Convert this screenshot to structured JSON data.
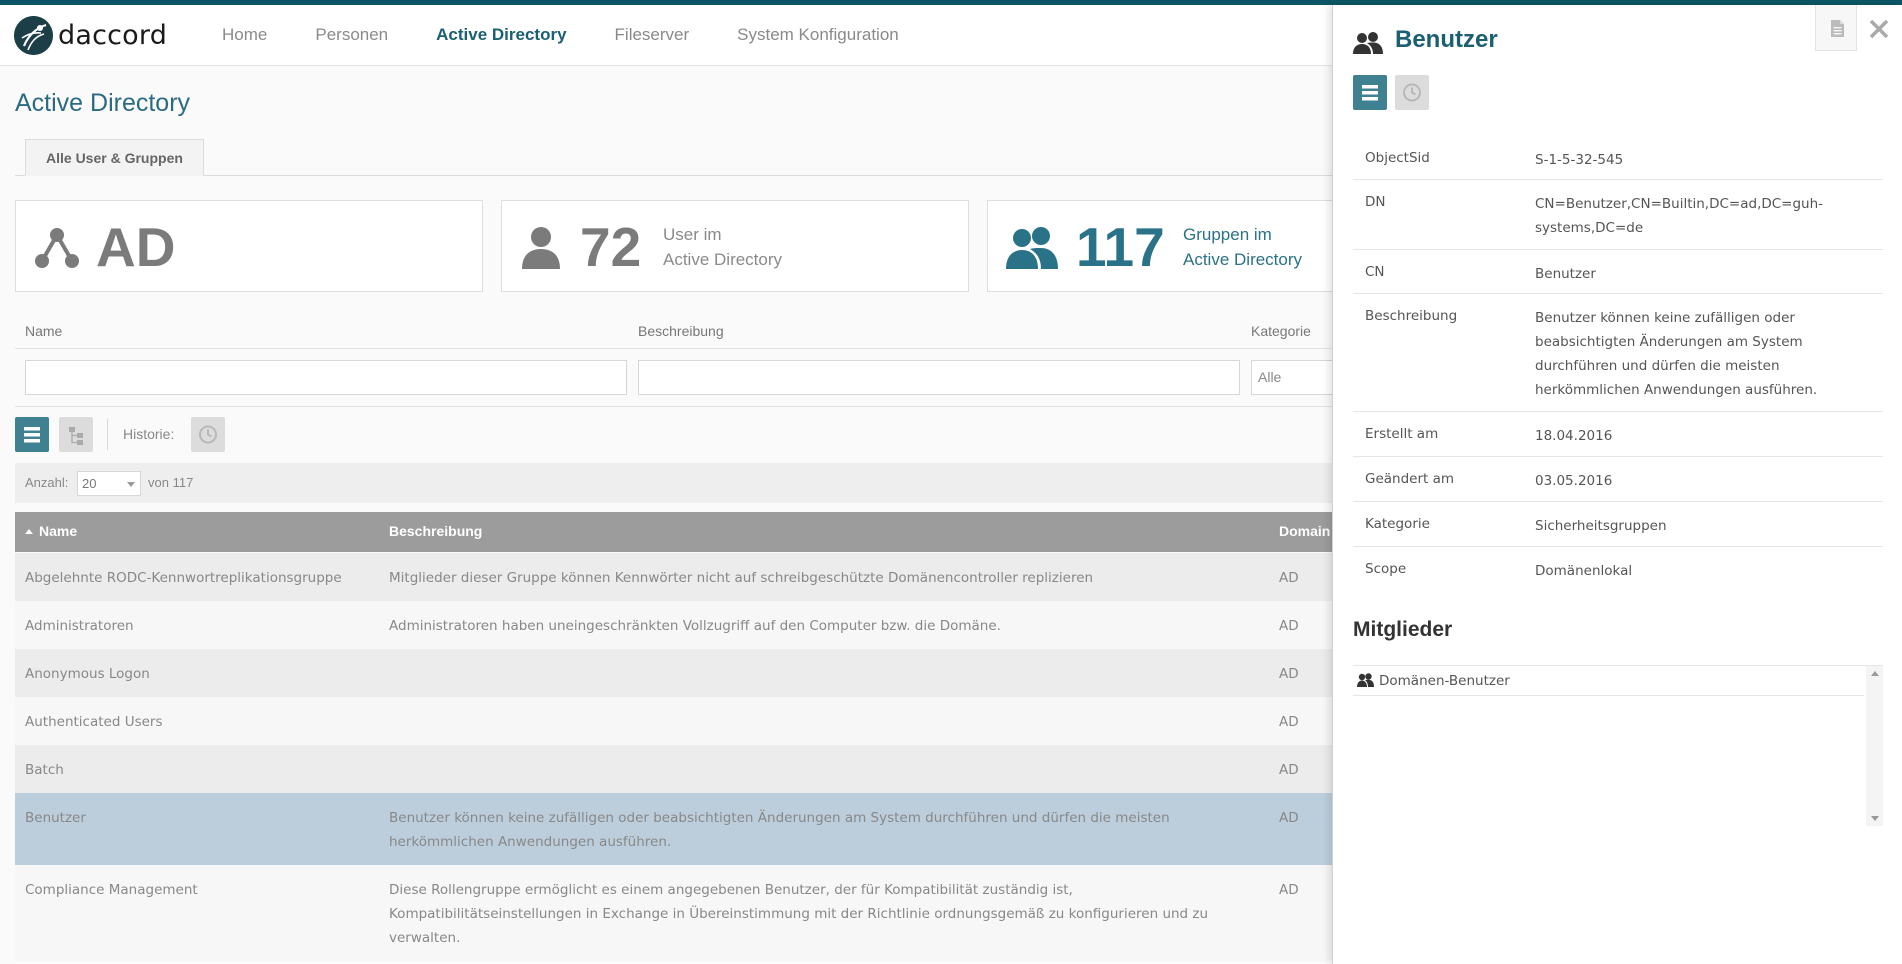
{
  "app": {
    "logo_text": "daccord",
    "nav": [
      "Home",
      "Personen",
      "Active Directory",
      "Fileserver",
      "System Konfiguration"
    ],
    "active_nav": "Active Directory"
  },
  "page": {
    "title": "Active Directory",
    "tab": "Alle User & Gruppen"
  },
  "stats": {
    "ad": {
      "value": "AD",
      "icon": "network-icon"
    },
    "users": {
      "value": "72",
      "line1": "User im",
      "line2": "Active Directory",
      "icon": "user-icon"
    },
    "groups": {
      "value": "117",
      "line1": "Gruppen im",
      "line2": "Active Directory",
      "icon": "users-icon",
      "color": "#2a7288"
    }
  },
  "filters": {
    "name_label": "Name",
    "description_label": "Beschreibung",
    "category_label": "Kategorie",
    "name_value": "",
    "description_value": "",
    "category_value": "Alle"
  },
  "toolbar": {
    "history_label": "Historie:"
  },
  "pagination": {
    "count_label": "Anzahl:",
    "page_size": "20",
    "of_label": "von 117"
  },
  "table": {
    "columns": [
      "Name",
      "Beschreibung",
      "Domain"
    ],
    "rows": [
      {
        "name": "Abgelehnte RODC-Kennwortreplikationsgruppe",
        "desc": [
          "Mitglieder dieser Gruppe können Kennwörter nicht auf schreibgeschützte Domänencontroller replizieren"
        ],
        "domain": "AD"
      },
      {
        "name": "Administratoren",
        "desc": [
          "Administratoren haben uneingeschränkten Vollzugriff auf den Computer bzw. die Domäne."
        ],
        "domain": "AD"
      },
      {
        "name": "Anonymous Logon",
        "desc": [],
        "domain": "AD"
      },
      {
        "name": "Authenticated Users",
        "desc": [],
        "domain": "AD"
      },
      {
        "name": "Batch",
        "desc": [],
        "domain": "AD"
      },
      {
        "name": "Benutzer",
        "desc": [
          "Benutzer können keine zufälligen oder beabsichtigten Änderungen am System durchführen und dürfen die meisten",
          "herkömmlichen Anwendungen ausführen."
        ],
        "domain": "AD",
        "selected": true
      },
      {
        "name": "Compliance Management",
        "desc": [
          "Diese Rollengruppe ermöglicht es einem angegebenen Benutzer, der für Kompatibilität zuständig ist,",
          "Kompatibilitätseinstellungen in Exchange in Übereinstimmung mit der Richtlinie ordnungsgemäß zu konfigurieren und zu",
          "verwalten."
        ],
        "domain": "AD"
      }
    ]
  },
  "detail": {
    "title": "Benutzer",
    "properties": [
      {
        "key": "ObjectSid",
        "value": [
          "S-1-5-32-545"
        ]
      },
      {
        "key": "DN",
        "value": [
          "CN=Benutzer,CN=Builtin,DC=ad,DC=guh-",
          "systems,DC=de"
        ]
      },
      {
        "key": "CN",
        "value": [
          "Benutzer"
        ]
      },
      {
        "key": "Beschreibung",
        "value": [
          "Benutzer können keine zufälligen oder",
          "beabsichtigten Änderungen am System",
          "durchführen und dürfen die meisten",
          "herkömmlichen Anwendungen ausführen."
        ]
      },
      {
        "key": "Erstellt am",
        "value": [
          "18.04.2016"
        ]
      },
      {
        "key": "Geändert am",
        "value": [
          "03.05.2016"
        ]
      },
      {
        "key": "Kategorie",
        "value": [
          "Sicherheitsgruppen"
        ]
      },
      {
        "key": "Scope",
        "value": [
          "Domänenlokal"
        ]
      }
    ],
    "members_title": "Mitglieder",
    "members": [
      "Domänen-Benutzer"
    ]
  }
}
